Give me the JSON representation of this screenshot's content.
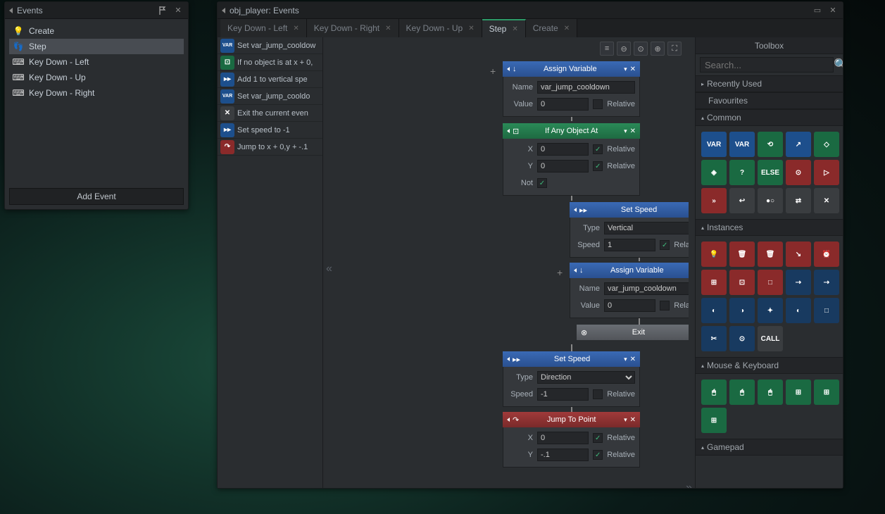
{
  "events_panel": {
    "title": "Events",
    "items": [
      {
        "label": "Create",
        "icon": "bulb"
      },
      {
        "label": "Step",
        "icon": "feet",
        "selected": true
      },
      {
        "label": "Key Down - Left",
        "icon": "key"
      },
      {
        "label": "Key Down - Up",
        "icon": "key"
      },
      {
        "label": "Key Down - Right",
        "icon": "key"
      }
    ],
    "add_button": "Add Event"
  },
  "main_window": {
    "title": "obj_player: Events",
    "tabs": [
      {
        "label": "Key Down - Left",
        "active": false
      },
      {
        "label": "Key Down - Right",
        "active": false
      },
      {
        "label": "Key Down - Up",
        "active": false
      },
      {
        "label": "Step",
        "active": true
      },
      {
        "label": "Create",
        "active": false
      }
    ],
    "actions": [
      {
        "text": "Set var_jump_cooldow",
        "color": "blue",
        "icon": "var"
      },
      {
        "text": "If no object is at x + 0,",
        "color": "green",
        "icon": "obj"
      },
      {
        "text": "   Add 1 to vertical spe",
        "color": "blue",
        "icon": "speed"
      },
      {
        "text": "   Set var_jump_cooldo",
        "color": "blue",
        "icon": "var"
      },
      {
        "text": "   Exit the current even",
        "color": "grey",
        "icon": "exit"
      },
      {
        "text": "Set speed to -1",
        "color": "blue",
        "icon": "speed"
      },
      {
        "text": "Jump to x + 0,y + -.1",
        "color": "red",
        "icon": "jump"
      }
    ],
    "nodes": {
      "assign1": {
        "title": "Assign Variable",
        "name_label": "Name",
        "name_val": "var_jump_cooldown",
        "value_label": "Value",
        "value_val": "0",
        "rel_label": "Relative",
        "rel_checked": false
      },
      "ifobj": {
        "title": "If Any Object At",
        "x_label": "X",
        "x_val": "0",
        "x_rel": true,
        "y_label": "Y",
        "y_val": "0",
        "y_rel": true,
        "not_label": "Not",
        "not_checked": true,
        "rel_label": "Relative"
      },
      "setspeed1": {
        "title": "Set Speed",
        "type_label": "Type",
        "type_val": "Vertical",
        "speed_label": "Speed",
        "speed_val": "1",
        "rel_label": "Relative",
        "rel_checked": true
      },
      "assign2": {
        "title": "Assign Variable",
        "name_label": "Name",
        "name_val": "var_jump_cooldown",
        "value_label": "Value",
        "value_val": "0",
        "rel_label": "Relative",
        "rel_checked": false
      },
      "exit": {
        "title": "Exit"
      },
      "setspeed2": {
        "title": "Set Speed",
        "type_label": "Type",
        "type_val": "Direction",
        "speed_label": "Speed",
        "speed_val": "-1",
        "rel_label": "Relative",
        "rel_checked": false
      },
      "jump": {
        "title": "Jump To Point",
        "x_label": "X",
        "x_val": "0",
        "x_rel": true,
        "y_label": "Y",
        "y_val": "-.1",
        "y_rel": true,
        "rel_label": "Relative"
      }
    },
    "toolbox": {
      "title": "Toolbox",
      "search_placeholder": "Search...",
      "sections": {
        "recent": "Recently Used",
        "favourites": "Favourites",
        "common": "Common",
        "instances": "Instances",
        "mouse": "Mouse & Keyboard",
        "gamepad": "Gamepad"
      },
      "common_items": [
        "VAR",
        "VAR",
        "⟲",
        "↗",
        "◇",
        "◈",
        "?",
        "ELSE",
        "⊙",
        "▷",
        "»",
        "↩",
        "●○",
        "⇄",
        "✕"
      ],
      "instances_items": [
        "💡",
        "🗑",
        "🗑",
        "↘",
        "⏰",
        "⊞",
        "⊡",
        "□",
        "⇢",
        "⇢",
        "◐",
        "◑",
        "✦",
        "◐",
        "□",
        "✂",
        "⊙",
        "CALL"
      ],
      "mouse_items": [
        "🖱",
        "🖱",
        "🖱",
        "⊞",
        "⊞",
        "⊞"
      ]
    }
  }
}
